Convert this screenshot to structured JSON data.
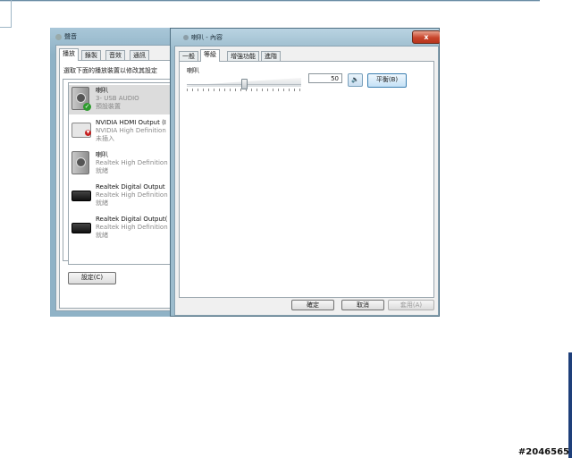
{
  "watermark": "#2046565",
  "sound_window": {
    "title": "聲音",
    "tabs": [
      "播放",
      "錄製",
      "音效",
      "通訊"
    ],
    "instruction": "選取下面的播放裝置以修改其設定",
    "devices": [
      {
        "name": "喇叭",
        "desc": "3- USB AUDIO",
        "status": "預設裝置",
        "icon": "speaker-icon",
        "badge": "default-check-icon"
      },
      {
        "name": "NVIDIA HDMI Output (I",
        "desc": "NVIDIA High Definition",
        "status": "未插入",
        "icon": "monitor-icon",
        "badge": "unplugged-icon"
      },
      {
        "name": "喇叭",
        "desc": "Realtek High Definition",
        "status": "就緒",
        "icon": "speaker-icon"
      },
      {
        "name": "Realtek Digital Output",
        "desc": "Realtek High Definition",
        "status": "就緒",
        "icon": "digital-output-icon"
      },
      {
        "name": "Realtek Digital Output(",
        "desc": "Realtek High Definition",
        "status": "就緒",
        "icon": "digital-output-icon"
      }
    ],
    "configure_label": "設定(C)"
  },
  "props_window": {
    "title": "喇叭 - 內容",
    "close_glyph": "x",
    "tabs": [
      "一般",
      "等級",
      "增強功能",
      "進階"
    ],
    "active_tab": 1,
    "level": {
      "label": "喇叭",
      "value": "50",
      "level_fraction": 0.5,
      "balance_label": "平衡(B)"
    },
    "buttons": {
      "ok": "確定",
      "cancel": "取消",
      "apply": "套用(A)"
    }
  }
}
